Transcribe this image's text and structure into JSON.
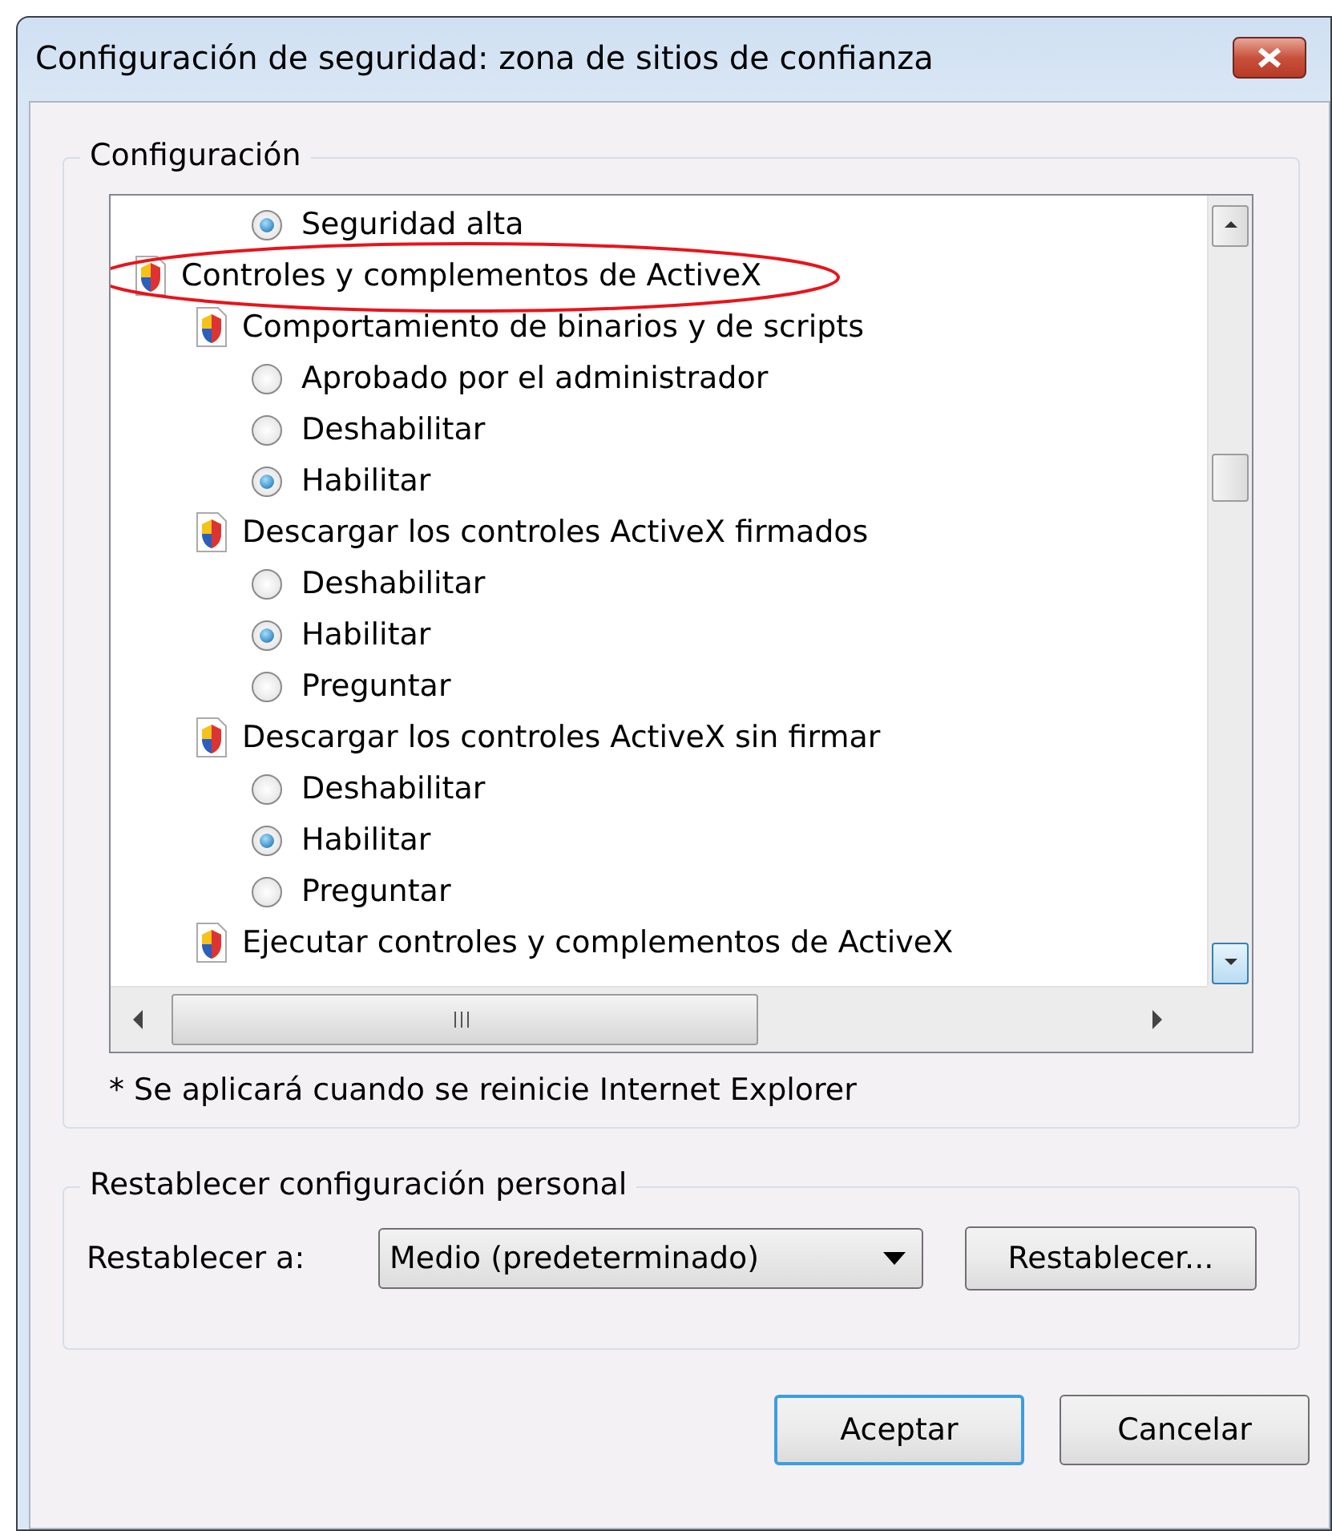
{
  "window": {
    "title": "Configuración de seguridad: zona de sitios de confianza"
  },
  "settings": {
    "title": "Configuración",
    "items": [
      {
        "kind": "option",
        "label": "Seguridad alta",
        "selected": true
      },
      {
        "kind": "category",
        "label": "Controles y complementos de ActiveX",
        "circled": true,
        "children": [
          {
            "kind": "category",
            "label": "Comportamiento de binarios y de scripts",
            "children": [
              {
                "kind": "option",
                "label": "Aprobado por el administrador",
                "selected": false
              },
              {
                "kind": "option",
                "label": "Deshabilitar",
                "selected": false
              },
              {
                "kind": "option",
                "label": "Habilitar",
                "selected": true
              }
            ]
          },
          {
            "kind": "category",
            "label": "Descargar los controles ActiveX firmados",
            "children": [
              {
                "kind": "option",
                "label": "Deshabilitar",
                "selected": false
              },
              {
                "kind": "option",
                "label": "Habilitar",
                "selected": true
              },
              {
                "kind": "option",
                "label": "Preguntar",
                "selected": false
              }
            ]
          },
          {
            "kind": "category",
            "label": "Descargar los controles ActiveX sin firmar",
            "children": [
              {
                "kind": "option",
                "label": "Deshabilitar",
                "selected": false
              },
              {
                "kind": "option",
                "label": "Habilitar",
                "selected": true
              },
              {
                "kind": "option",
                "label": "Preguntar",
                "selected": false
              }
            ]
          },
          {
            "kind": "category",
            "label": "Ejecutar controles y complementos de ActiveX"
          }
        ]
      }
    ],
    "note": "* Se aplicará cuando se reinicie Internet Explorer"
  },
  "reset": {
    "title": "Restablecer configuración personal",
    "label": "Restablecer a:",
    "value": "Medio (predeterminado)",
    "button": "Restablecer..."
  },
  "buttons": [
    "Aceptar",
    "Cancelar"
  ]
}
